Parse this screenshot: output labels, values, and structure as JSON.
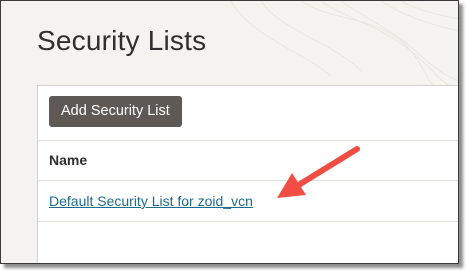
{
  "page": {
    "title": "Security Lists"
  },
  "toolbar": {
    "add_label": "Add Security List"
  },
  "table": {
    "columns": [
      "Name"
    ],
    "rows": [
      {
        "name": "Default Security List for zoid_vcn"
      }
    ]
  },
  "annotation": {
    "icon": "arrow-icon",
    "color": "#f04e45"
  },
  "colors": {
    "link": "#1f6b8c",
    "button": "#5e5954",
    "background": "#f4f3ef"
  }
}
